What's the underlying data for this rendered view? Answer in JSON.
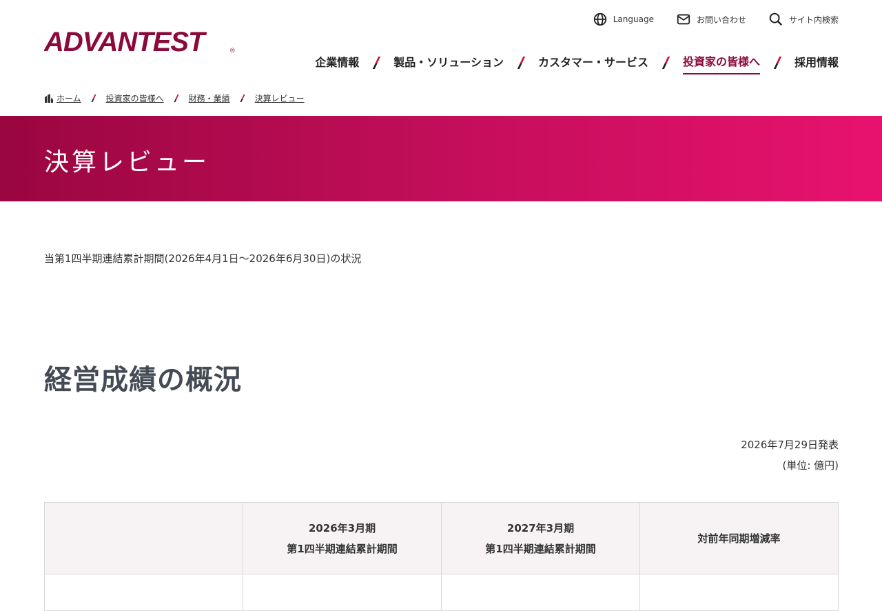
{
  "brand": {
    "name": "ADVANTEST",
    "color": "#8b0a3c"
  },
  "utility_nav": [
    {
      "label": "Language",
      "icon": "globe-icon"
    },
    {
      "label": "お問い合わせ",
      "icon": "mail-icon"
    },
    {
      "label": "サイト内検索",
      "icon": "search-icon"
    }
  ],
  "global_nav": {
    "items": [
      {
        "label": "企業情報"
      },
      {
        "label": "製品・ソリューション"
      },
      {
        "label": "カスタマー・サービス"
      },
      {
        "label": "投資家の皆様へ",
        "active": true
      },
      {
        "label": "採用情報"
      }
    ]
  },
  "breadcrumb": [
    "ホーム",
    "投資家の皆様へ",
    "財務・業績",
    "決算レビュー"
  ],
  "banner": {
    "title": "決算レビュー",
    "gradient_start": "#9a063f",
    "gradient_end": "#e8126e"
  },
  "period_text": "当第1四半期連結累計期間(2026年4月1日～2026年6月30日)の状況",
  "section": {
    "title": "経営成績の概況"
  },
  "announcement": {
    "date": "2026年7月29日発表",
    "unit": "(単位: 億円)"
  },
  "table": {
    "headers": [
      {
        "line1": "",
        "line2": ""
      },
      {
        "line1": "2026年3月期",
        "line2": "第1四半期連結累計期間"
      },
      {
        "line1": "2027年3月期",
        "line2": "第1四半期連結累計期間"
      },
      {
        "line1": "対前年同期増減率",
        "line2": ""
      }
    ]
  }
}
